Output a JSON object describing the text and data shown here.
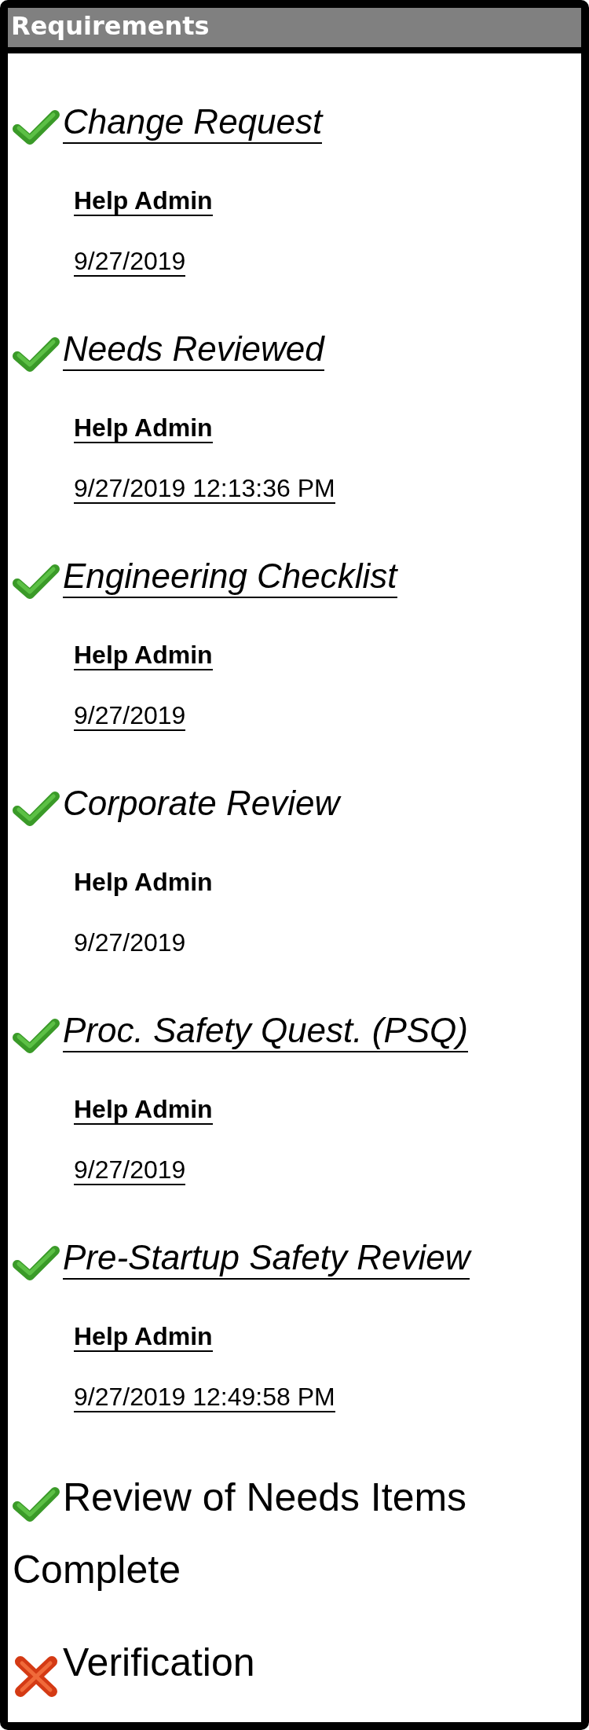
{
  "panel": {
    "title": "Requirements"
  },
  "items": [
    {
      "kind": "task",
      "title": "Change Request",
      "linked": true,
      "complete": true,
      "author": "Help Admin",
      "date": "9/27/2019"
    },
    {
      "kind": "task",
      "title": "Needs Reviewed",
      "linked": true,
      "complete": true,
      "author": "Help Admin",
      "date": "9/27/2019 12:13:36 PM"
    },
    {
      "kind": "task",
      "title": "Engineering Checklist",
      "linked": true,
      "complete": true,
      "author": "Help Admin",
      "date": "9/27/2019"
    },
    {
      "kind": "task",
      "title": "Corporate Review",
      "linked": false,
      "complete": true,
      "author": "Help Admin",
      "date": "9/27/2019"
    },
    {
      "kind": "task",
      "title": "Proc. Safety Quest. (PSQ)",
      "linked": true,
      "complete": true,
      "author": "Help Admin",
      "date": "9/27/2019"
    },
    {
      "kind": "task",
      "title": "Pre-Startup Safety Review",
      "linked": true,
      "complete": true,
      "author": "Help Admin",
      "date": "9/27/2019 12:49:58 PM"
    },
    {
      "kind": "milestone",
      "title": "Review of Needs Items Complete",
      "complete": true
    },
    {
      "kind": "milestone",
      "title": "Verification",
      "complete": false
    }
  ]
}
